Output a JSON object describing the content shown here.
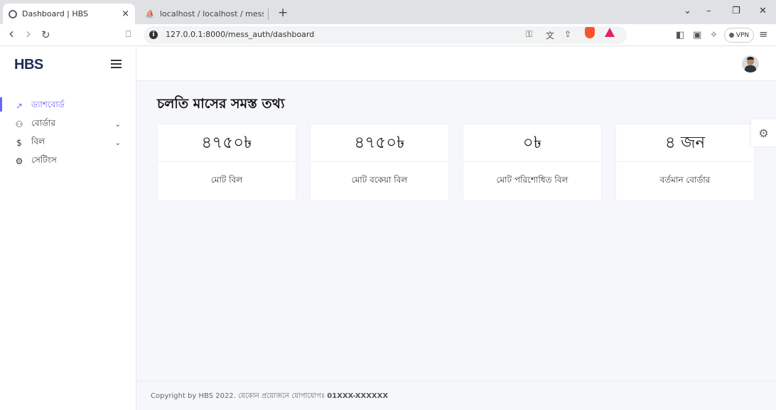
{
  "browser": {
    "tabs": [
      {
        "title": "Dashboard | HBS",
        "close": "×"
      },
      {
        "title": "localhost / localhost / mess_manage"
      }
    ],
    "new_tab": "+",
    "window_controls": {
      "dropdown": "⌄",
      "minimize": "–",
      "restore": "❐",
      "close": "✕"
    },
    "nav": {
      "back": "‹",
      "forward": "›",
      "reload": "↻",
      "bookmark": "⎕"
    },
    "url": "127.0.0.1:8000/mess_auth/dashboard",
    "info_icon": "i",
    "vpn_label": "VPN",
    "icons": [
      "key-icon",
      "translate-icon",
      "share-icon",
      "brave-shield-icon",
      "brave-rewards-icon",
      "sidebar-icon",
      "wallet-icon",
      "leo-icon",
      "menu-icon"
    ],
    "colors": {
      "brave": "#fb542b",
      "rewards": "#e0245e"
    }
  },
  "sidebar": {
    "logo": "HBS",
    "items": [
      {
        "icon": "↗",
        "label": "ড্যাশবোর্ড",
        "active": true
      },
      {
        "icon": "⚇",
        "label": "বোর্ডার",
        "chevron": "⌄"
      },
      {
        "icon": "$",
        "label": "বিল",
        "chevron": "⌄"
      },
      {
        "icon": "⚙",
        "label": "সেটিংস"
      }
    ],
    "accent_color": "#6c63ff"
  },
  "main": {
    "heading": "চলতি মাসের সমস্ত তথ্য",
    "cards": [
      {
        "value": "৪৭৫০৳",
        "label": "মোট বিল"
      },
      {
        "value": "৪৭৫০৳",
        "label": "মোট বকেয়া বিল"
      },
      {
        "value": "০৳",
        "label": "মোট পরিশোধিত বিল"
      },
      {
        "value": "৪ জন",
        "label": "বর্তমান বোর্ডার"
      }
    ],
    "settings_icon": "⚙"
  },
  "footer": {
    "text": "Copyright by HBS 2022. যেকোন প্রয়োজনে যোগাযোগঃ ",
    "phone": "01XXX-XXXXXX"
  }
}
